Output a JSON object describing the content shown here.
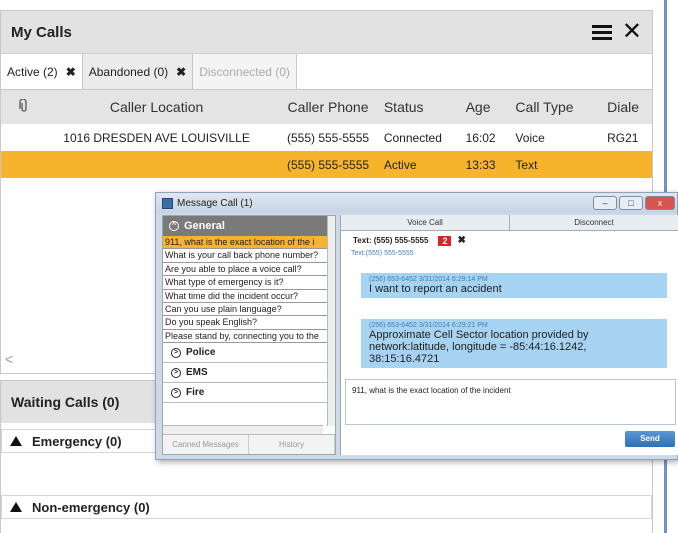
{
  "my_calls": {
    "title": "My Calls",
    "tabs": [
      {
        "label": "Active (2)",
        "close": "✖"
      },
      {
        "label": "Abandoned (0)",
        "close": "✖"
      },
      {
        "label": "Disconnected (0)"
      }
    ],
    "columns": [
      "Caller Location",
      "Caller Phone",
      "Status",
      "Age",
      "Call Type",
      "Diale"
    ],
    "rows": [
      {
        "location": "1016 DRESDEN AVE LOUISVILLE",
        "phone": "(555) 555-5555",
        "status": "Connected",
        "age": "16:02",
        "type": "Voice",
        "dialer": "RG21"
      },
      {
        "location": "",
        "phone": "(555) 555-5555",
        "status": "Active",
        "age": "13:33",
        "type": "Text",
        "dialer": ""
      }
    ],
    "scroll_left": "<"
  },
  "waiting_calls": {
    "title": "Waiting Calls (0)",
    "groups": [
      "Emergency (0)",
      "Non-emergency (0)"
    ]
  },
  "message_window": {
    "title": "Message Call (1)",
    "section": "General",
    "messages": [
      "911, what is the exact location of the i",
      "What is your call back phone number?",
      "Are you able to place a voice call?",
      "What type of emergency is it?",
      "What time did the incident occur?",
      "Can you use plain language?",
      "Do you speak English?",
      "Please stand by, connecting you to the"
    ],
    "categories": [
      "Police",
      "EMS",
      "Fire"
    ],
    "bottom_tabs": [
      "Canned Messages",
      "History"
    ],
    "call_tabs": [
      "Voice Call",
      "Disconnect"
    ],
    "conversation_tab": "Text: (555) 555-5555",
    "unread_count": "2",
    "conversation_sub": "Text:(555) 555-5555",
    "bubbles": [
      {
        "meta": "(256) 653-6452 3/31/2014 6:29:14 PM",
        "text": "I want to report an accident"
      },
      {
        "meta": "(256) 653-6452 3/31/2014 6:29:21 PM",
        "text": "Approximate Cell Sector location provided by network:latitude, longitude = -85:44:16.1242, 38:15:16.4721"
      }
    ],
    "compose_text": "911, what is the exact location of the incident",
    "send_label": "Send"
  }
}
